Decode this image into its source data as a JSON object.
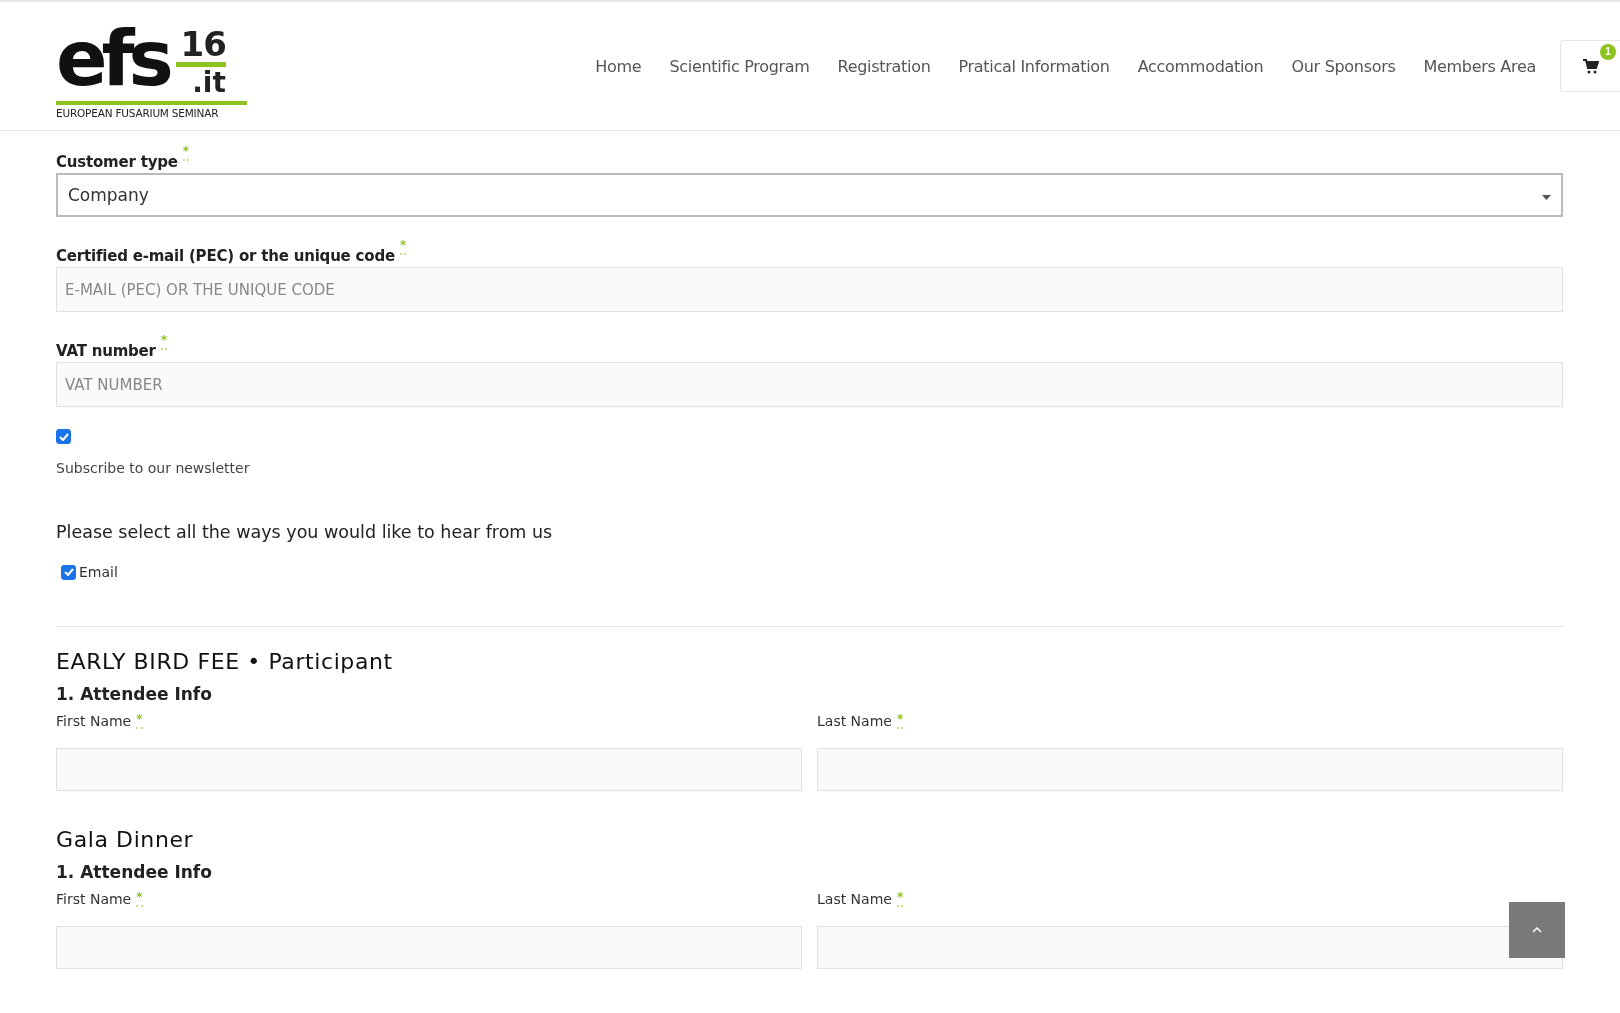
{
  "logo": {
    "letters": "efs",
    "number": "16",
    "domain": ".it",
    "tagline": "EUROPEAN FUSARIUM SEMINAR"
  },
  "nav": [
    {
      "label": "Home"
    },
    {
      "label": "Scientific Program"
    },
    {
      "label": "Registration"
    },
    {
      "label": "Pratical Information"
    },
    {
      "label": "Accommodation"
    },
    {
      "label": "Our Sponsors"
    },
    {
      "label": "Members Area"
    }
  ],
  "cart": {
    "count": "1"
  },
  "billing_fields": [
    {
      "kind": "select",
      "label": "Customer type",
      "required_mark": "*",
      "value": "Company"
    },
    {
      "kind": "text",
      "label": "Certified e-mail (PEC) or the unique code",
      "required_mark": "*",
      "placeholder": "E-MAIL (PEC) OR THE UNIQUE CODE"
    },
    {
      "kind": "text",
      "label": "VAT number",
      "required_mark": "*",
      "placeholder": "VAT NUMBER"
    }
  ],
  "newsletter": {
    "checked": true,
    "label": "Subscribe to our newsletter"
  },
  "contact_prompt": "Please select all the ways you would like to hear from us",
  "contact_options": [
    {
      "label": "Email",
      "checked": true
    }
  ],
  "tickets": [
    {
      "title": "EARLY BIRD FEE • Participant",
      "subtitle": "1. Attendee Info",
      "fields": [
        {
          "label": "First Name",
          "required_mark": "*"
        },
        {
          "label": "Last Name",
          "required_mark": "*"
        }
      ]
    },
    {
      "title": "Gala Dinner",
      "subtitle": "1. Attendee Info",
      "fields": [
        {
          "label": "First Name",
          "required_mark": "*"
        },
        {
          "label": "Last Name",
          "required_mark": "*"
        }
      ]
    }
  ]
}
